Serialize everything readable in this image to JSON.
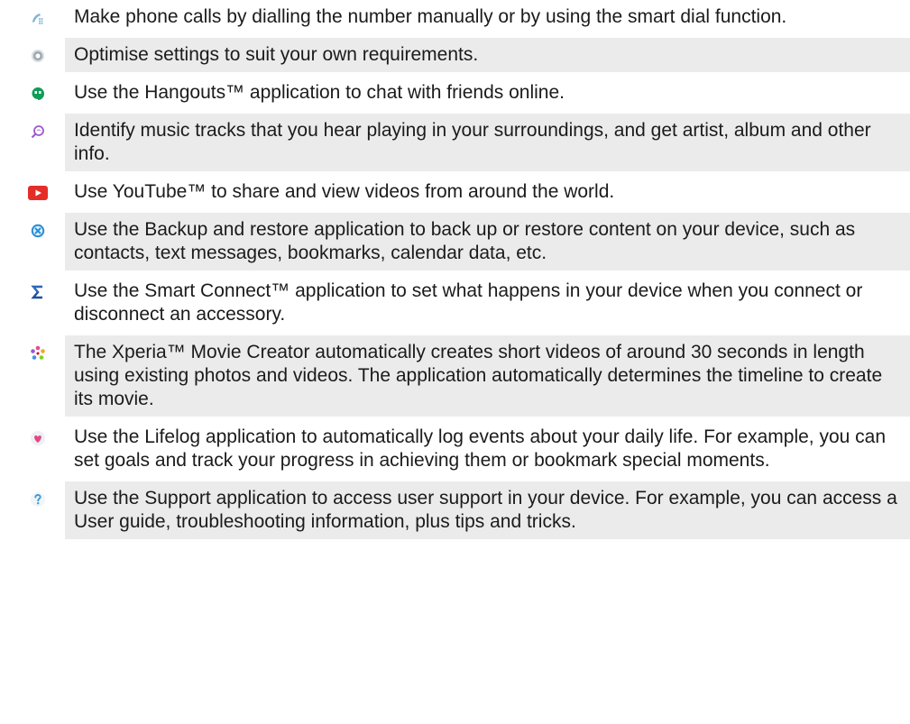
{
  "items": [
    {
      "icon": "phone-dialer-icon",
      "text": "Make phone calls by dialling the number manually or by using the smart dial function."
    },
    {
      "icon": "settings-icon",
      "text": "Optimise settings to suit your own requirements."
    },
    {
      "icon": "hangouts-icon",
      "text": "Use the Hangouts™ application to chat with friends online."
    },
    {
      "icon": "music-recognition-icon",
      "text": "Identify music tracks that you hear playing in your surroundings, and get artist, album and other info."
    },
    {
      "icon": "youtube-icon",
      "text": "Use YouTube™ to share and view videos from around the world."
    },
    {
      "icon": "backup-restore-icon",
      "text": "Use the Backup and restore application to back up or restore content on your device, such as contacts, text messages, bookmarks, calendar data, etc."
    },
    {
      "icon": "smart-connect-icon",
      "text": "Use the Smart Connect™ application to set what happens in your device when you connect or disconnect an accessory."
    },
    {
      "icon": "movie-creator-icon",
      "text": "The Xperia™ Movie Creator automatically creates short videos of around 30 seconds in length using existing photos and videos. The application automatically determines the timeline to create its movie."
    },
    {
      "icon": "lifelog-icon",
      "text": "Use the Lifelog application to automatically log events about your daily life. For example, you can set goals and track your progress in achieving them or bookmark special moments."
    },
    {
      "icon": "support-icon",
      "text": "Use the Support application to access user support in your device. For example, you can access a User guide, troubleshooting information, plus tips and tricks."
    }
  ],
  "colors": {
    "row_shade": "#ebebeb",
    "youtube_red": "#e52d27",
    "hangouts_green": "#0f9d58",
    "backup_blue": "#2a8fd6"
  }
}
